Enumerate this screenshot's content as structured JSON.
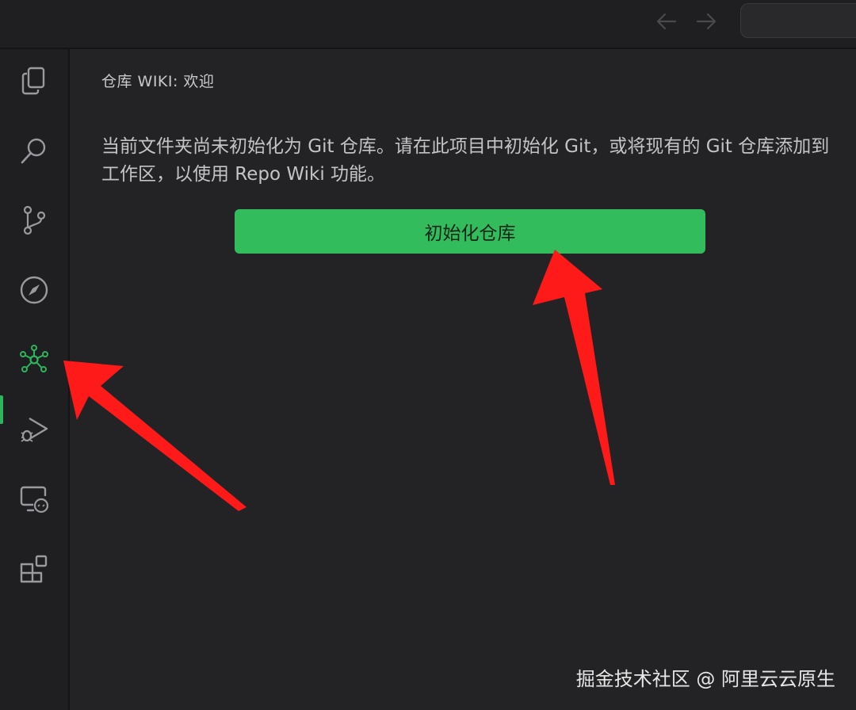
{
  "titlebar": {
    "back_icon": "arrow-left-icon",
    "forward_icon": "arrow-right-icon"
  },
  "activitybar": {
    "items": [
      {
        "icon": "explorer-icon"
      },
      {
        "icon": "search-icon"
      },
      {
        "icon": "source-control-icon"
      },
      {
        "icon": "compass-icon"
      },
      {
        "icon": "repo-wiki-icon",
        "active": true
      },
      {
        "icon": "run-debug-icon"
      },
      {
        "icon": "remote-explorer-icon"
      },
      {
        "icon": "extensions-icon"
      }
    ]
  },
  "main": {
    "title": "仓库 WIKI: 欢迎",
    "message": "当前文件夹尚未初始化为 Git 仓库。请在此项目中初始化 Git，或将现有的 Git 仓库添加到工作区，以使用 Repo Wiki 功能。",
    "init_button_label": "初始化仓库"
  },
  "watermark": "掘金技术社区 @ 阿里云云原生",
  "colors": {
    "accent": "#32bc5c",
    "annotation_arrow": "#ff1a1a",
    "background": "#232325"
  }
}
